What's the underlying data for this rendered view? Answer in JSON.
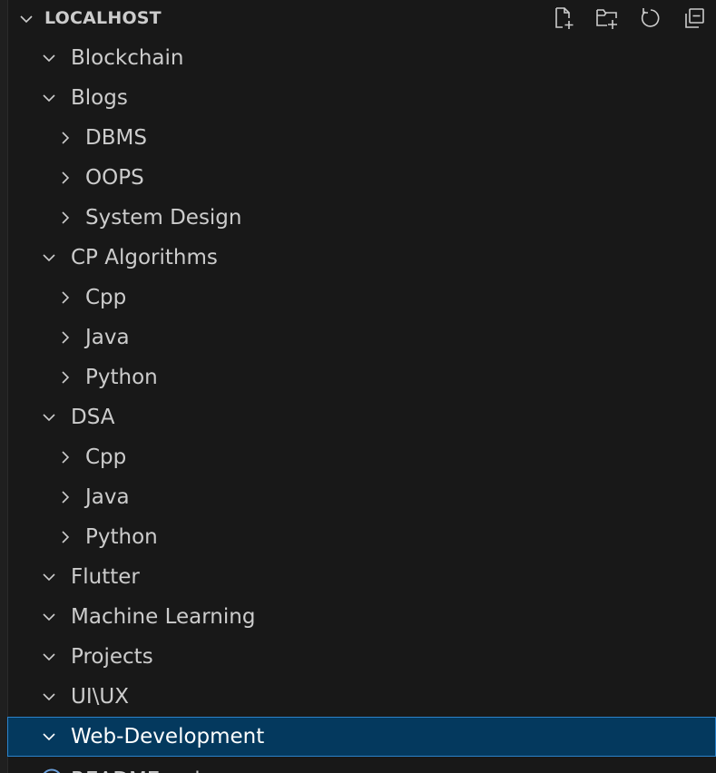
{
  "explorer": {
    "section_title": "LOCALHOST",
    "actions": [
      {
        "icon": "new-file-icon",
        "name": "new-file-button"
      },
      {
        "icon": "new-folder-icon",
        "name": "new-folder-button"
      },
      {
        "icon": "refresh-icon",
        "name": "refresh-button"
      },
      {
        "icon": "collapse-all-icon",
        "name": "collapse-all-button"
      }
    ],
    "tree": [
      {
        "label": "Blockchain",
        "level": 0,
        "expanded": true
      },
      {
        "label": "Blogs",
        "level": 0,
        "expanded": true
      },
      {
        "label": "DBMS",
        "level": 1,
        "expanded": false
      },
      {
        "label": "OOPS",
        "level": 1,
        "expanded": false
      },
      {
        "label": "System Design",
        "level": 1,
        "expanded": false
      },
      {
        "label": "CP Algorithms",
        "level": 0,
        "expanded": true
      },
      {
        "label": "Cpp",
        "level": 1,
        "expanded": false
      },
      {
        "label": "Java",
        "level": 1,
        "expanded": false
      },
      {
        "label": "Python",
        "level": 1,
        "expanded": false
      },
      {
        "label": "DSA",
        "level": 0,
        "expanded": true
      },
      {
        "label": "Cpp",
        "level": 1,
        "expanded": false
      },
      {
        "label": "Java",
        "level": 1,
        "expanded": false
      },
      {
        "label": "Python",
        "level": 1,
        "expanded": false
      },
      {
        "label": "Flutter",
        "level": 0,
        "expanded": true
      },
      {
        "label": "Machine Learning",
        "level": 0,
        "expanded": true
      },
      {
        "label": "Projects",
        "level": 0,
        "expanded": true
      },
      {
        "label": "UI\\UX",
        "level": 0,
        "expanded": true
      },
      {
        "label": "Web-Development",
        "level": 0,
        "expanded": true,
        "selected": true
      }
    ],
    "readme": {
      "label": "README.md",
      "icon": "info-icon"
    },
    "colors": {
      "background": "#181818",
      "text": "#cccccc",
      "selection_bg": "#04395e",
      "selection_border": "#2c82c9"
    }
  }
}
